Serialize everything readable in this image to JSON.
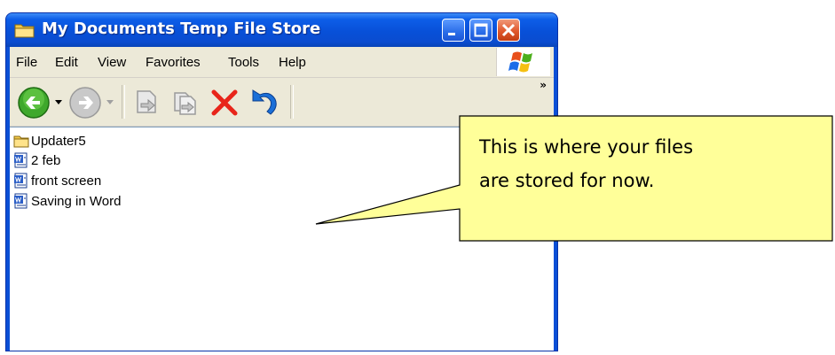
{
  "window": {
    "title": "My Documents Temp File Store",
    "accent_color": "#0a4fd6",
    "title_icon": "folder-icon",
    "caption_buttons": [
      "minimize-icon",
      "maximize-icon",
      "close-icon"
    ]
  },
  "menu": {
    "items": [
      "File",
      "Edit",
      "View",
      "Favorites",
      "Tools",
      "Help"
    ],
    "logo_icon": "windows-flag-icon"
  },
  "toolbar": {
    "icons": [
      "back-icon",
      "back-dropdown-icon",
      "forward-icon",
      "forward-dropdown-icon",
      "move-to-icon",
      "copy-to-icon",
      "delete-icon",
      "undo-icon"
    ],
    "more_label": "»"
  },
  "files": [
    {
      "name": "Updater5",
      "icon": "folder-icon"
    },
    {
      "name": "2 feb",
      "icon": "word-document-icon"
    },
    {
      "name": "front screen",
      "icon": "word-document-icon"
    },
    {
      "name": "Saving in Word",
      "icon": "word-document-icon"
    }
  ],
  "callout": {
    "line1": "This is where your files",
    "line2": "are stored for now.",
    "fill_color": "#ffff99"
  }
}
